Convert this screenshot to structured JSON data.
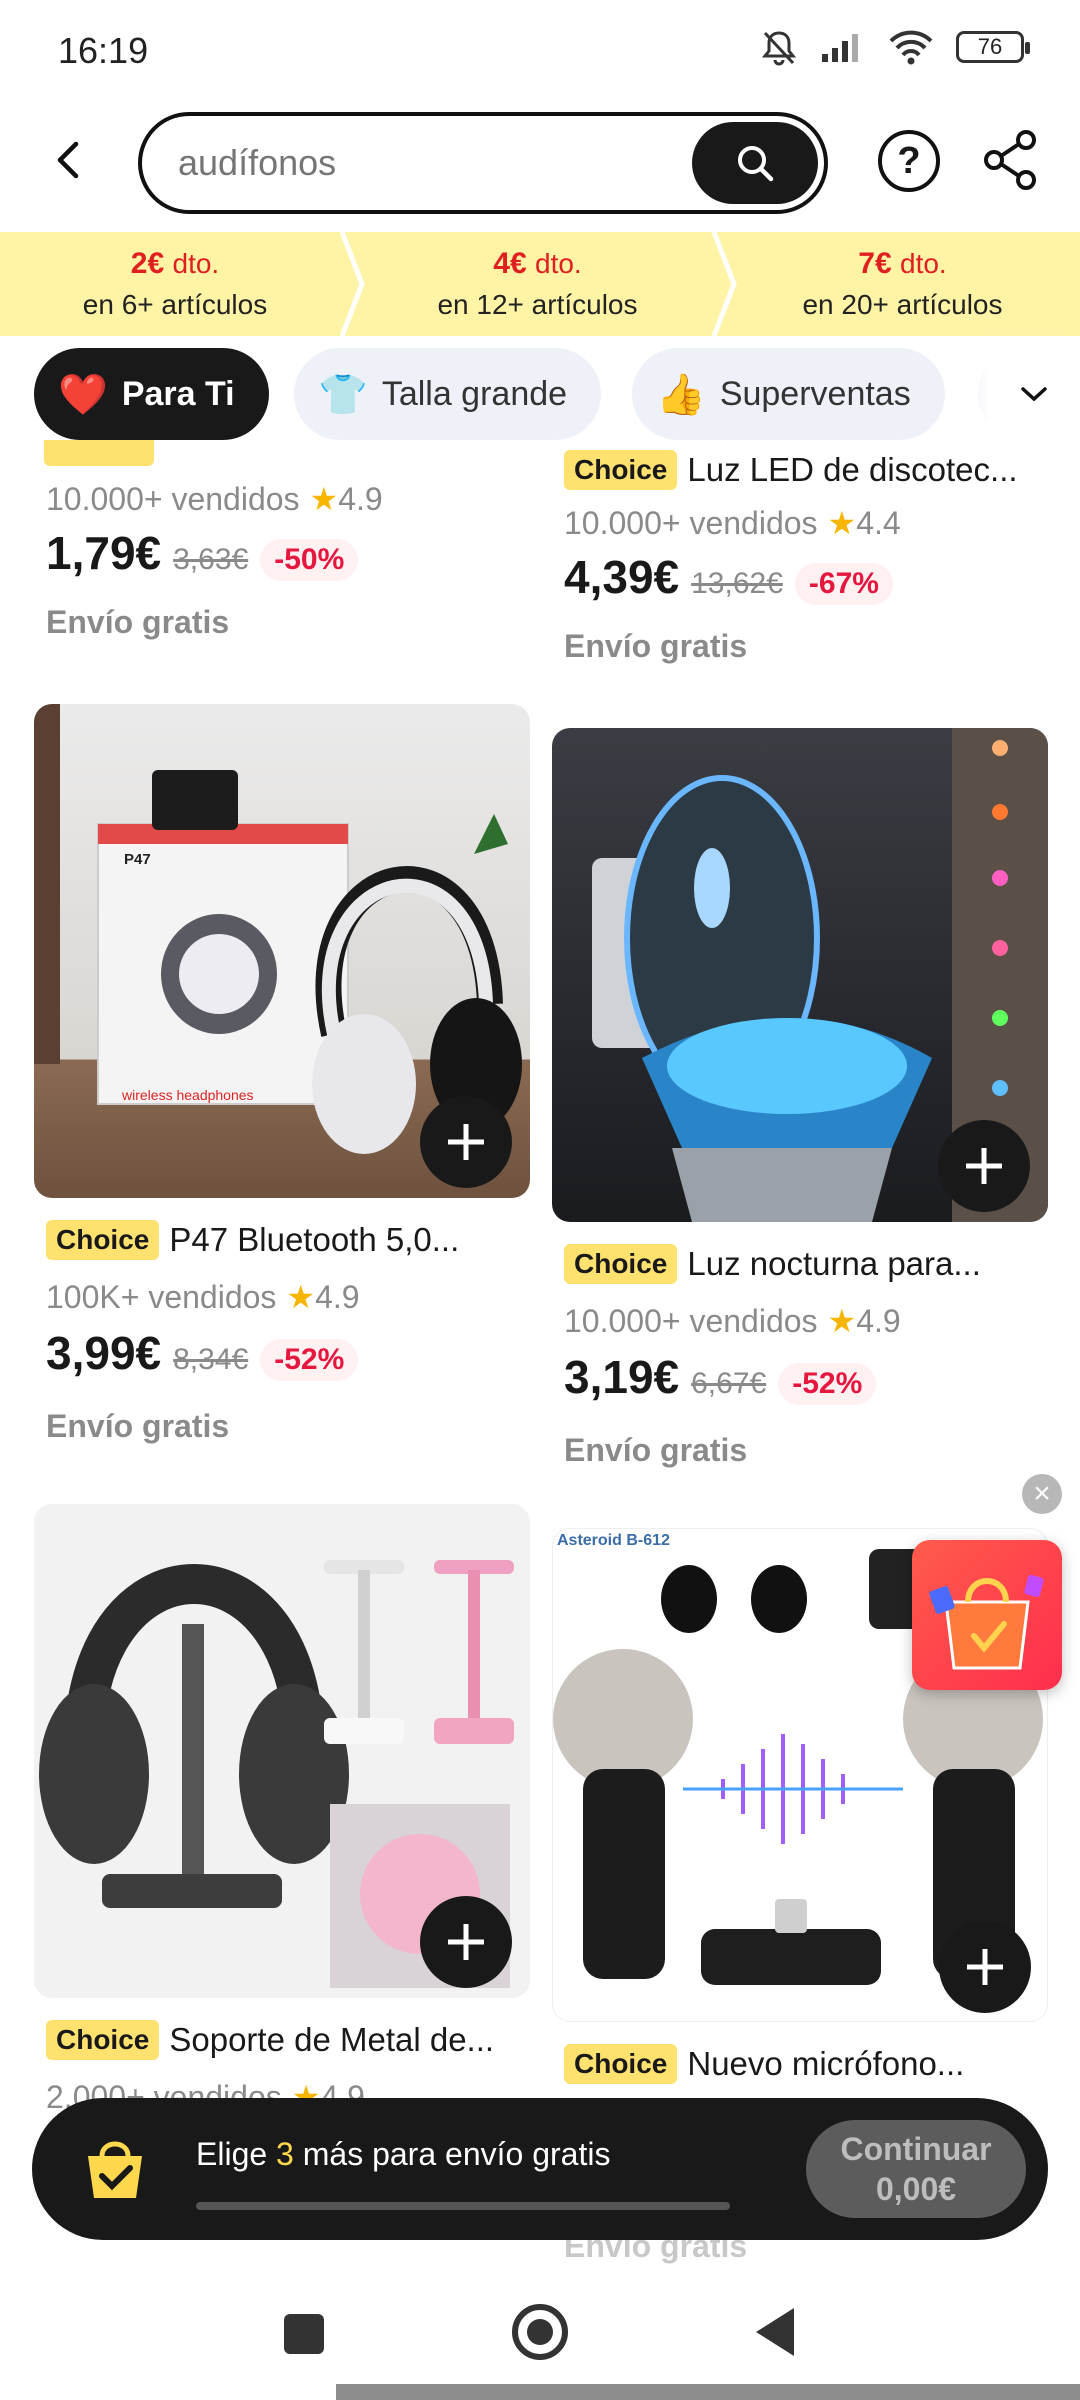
{
  "status_bar": {
    "time": "16:19",
    "battery": "76"
  },
  "search": {
    "placeholder": "audífonos"
  },
  "icons": {
    "back": "chevron-left-icon",
    "search": "search-icon",
    "help": "question-circle-icon",
    "share": "share-icon",
    "expand": "chevron-down-icon"
  },
  "help_label": "?",
  "discounts": [
    {
      "amount": "2€",
      "dto": "dto.",
      "sub": "en 6+ artículos"
    },
    {
      "amount": "4€",
      "dto": "dto.",
      "sub": "en 12+ artículos"
    },
    {
      "amount": "7€",
      "dto": "dto.",
      "sub": "en 20+ artículos"
    }
  ],
  "chips": [
    {
      "emoji": "❤️",
      "label": "Para Ti",
      "active": true
    },
    {
      "emoji": "👕",
      "label": "Talla grande",
      "active": false
    },
    {
      "emoji": "👍",
      "label": "Superventas",
      "active": false
    }
  ],
  "products": [
    {
      "choice": "",
      "title": "",
      "sold": "10.000+ vendidos",
      "rating": "4.9",
      "price": "1,79€",
      "old_price": "3,63€",
      "discount": "-50%",
      "shipping": "Envío gratis"
    },
    {
      "choice": "Choice",
      "title": "Luz LED de discotec...",
      "sold": "10.000+ vendidos",
      "rating": "4.4",
      "price": "4,39€",
      "old_price": "13,62€",
      "discount": "-67%",
      "shipping": "Envío gratis"
    },
    {
      "choice": "Choice",
      "title": "P47 Bluetooth 5,0...",
      "sold": "100K+ vendidos",
      "rating": "4.9",
      "price": "3,99€",
      "old_price": "8,34€",
      "discount": "-52%",
      "shipping": "Envío gratis",
      "image_text": {
        "model": "P47",
        "tagline": "wireless headphones"
      }
    },
    {
      "choice": "Choice",
      "title": "Luz nocturna para...",
      "sold": "10.000+ vendidos",
      "rating": "4.9",
      "price": "3,19€",
      "old_price": "6,67€",
      "discount": "-52%",
      "shipping": "Envío gratis"
    },
    {
      "choice": "Choice",
      "title": "Soporte de Metal de...",
      "sold": "2.000+ vendidos",
      "rating": "4.9"
    },
    {
      "choice": "Choice",
      "title": "Nuevo micrófono...",
      "shipping": "Envío gratis",
      "image_text": {
        "brand": "Asteroid B-612"
      }
    }
  ],
  "free_shipping_bar": {
    "text_before": "Elige ",
    "count": "3",
    "text_after": " más para envío gratis",
    "button_line1": "Continuar",
    "button_line2": "0,00€",
    "progress": 0
  },
  "colors": {
    "accent_red": "#e02020",
    "banner_yellow": "#fff3a6",
    "choice_yellow": "#ffe170",
    "dark": "#191919"
  }
}
